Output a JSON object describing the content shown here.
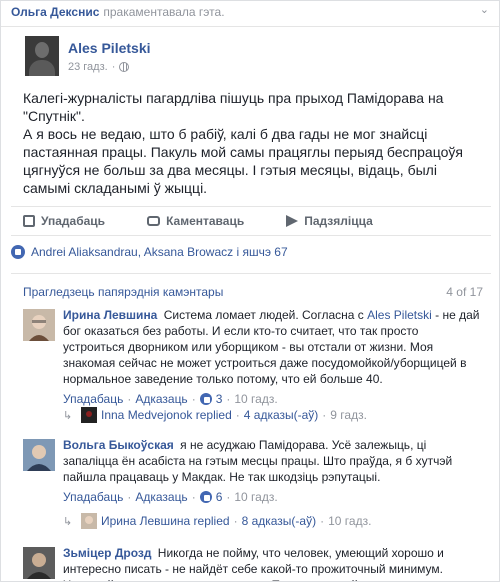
{
  "strip": {
    "name": "Ольга Декснис",
    "text": "пракаментавала гэта.",
    "chevron": "chevron-down-icon"
  },
  "post": {
    "author": "Ales Piletski",
    "time": "23 гадз.",
    "dot": "·",
    "text": [
      "Калегі-журналісты пагардліва пішуць пра прыход Памідорава на \"Спутнік\".",
      "А я вось не ведаю, што б рабіў, калі б два гады не мог знайсці пастаянная працы. Пакуль мой самы працяглы перыяд беспрацоўя цягнуўся не больш за два месяцы. І гэтыя месяцы, відаць, былі самымі складанымі ў жыцці."
    ]
  },
  "actions": {
    "like": "Упадабаць",
    "comment": "Каментаваць",
    "share": "Падзяліцца"
  },
  "likes": {
    "text": "Andrei Aliaksandrau, Aksana Browacz і яшчэ 67"
  },
  "comments_header": {
    "view_prev": "Прагледзець папярэднія камэнтары",
    "count": "4 of 17"
  },
  "comments": [
    {
      "name": "Ирина Левшина",
      "text_before": "Система ломает людей. Согласна с ",
      "mention": "Ales Piletski",
      "text_after": " - не дай бог оказаться без работы. И если кто-то считает, что так просто устроиться дворником или уборщиком - вы отстали от жизни. Моя знакомая сейчас не может устроиться даже посудомойкой/уборщицей в нормальное заведение только потому, что ей больше 40.",
      "like": "Упадабаць",
      "reply": "Адказаць",
      "likes": "3",
      "time": "10 гадз.",
      "reply_row": {
        "name": "Inna Medvejonok replied",
        "replies": "4 адказы(-аў)",
        "time": "9 гадз."
      }
    },
    {
      "name": "Вольга Быкоўская",
      "text_before": "я не асуджаю Памідорава. Усё залежыць, ці запаліцца ён асабіста на гэтым месцы працы. Што праўда, я б хутчэй пайшла працаваць у Макдак. Не так шкодзіць рэпутацыі.",
      "like": "Упадабаць",
      "reply": "Адказаць",
      "likes": "6",
      "time": "10 гадз.",
      "reply_row": {
        "name": "Ирина Левшина replied",
        "replies": "8 адказы(-аў)",
        "time": "10 гадз."
      }
    },
    {
      "name": "Зьміцер Дрозд",
      "text_before": "Никогда не пойму, что человек, умеющий хорошо и интересно писать - не найдёт себе какой-то прожиточный минимум. Хороший материал - всегда находит. Просто ты свой талант, похоже, не..."
    }
  ]
}
